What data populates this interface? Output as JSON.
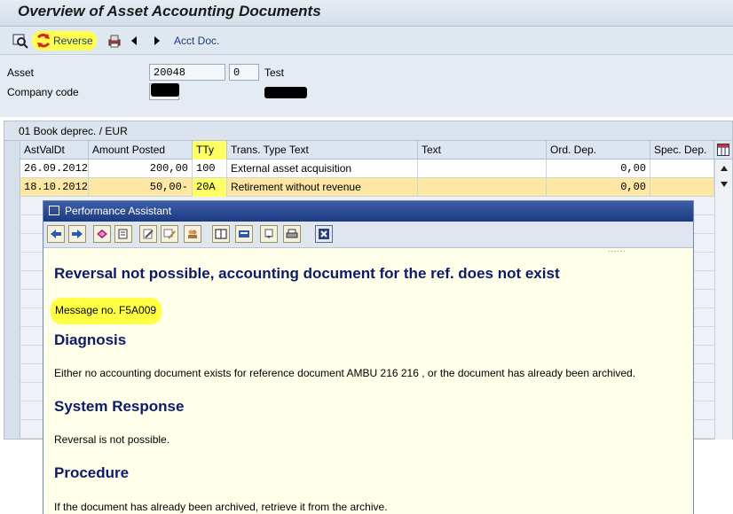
{
  "window": {
    "title": "Overview of Asset Accounting Documents"
  },
  "toolbar": {
    "reverse_label": "Reverse",
    "acct_doc_label": "Acct Doc."
  },
  "header": {
    "asset_label": "Asset",
    "asset_number": "20048",
    "asset_subnumber": "0",
    "asset_description": "Test",
    "company_code_label": "Company code"
  },
  "table": {
    "title": "01 Book deprec. / EUR",
    "columns": [
      "AstValDt",
      "Amount Posted",
      "TTy",
      "Trans. Type Text",
      "Text",
      "Ord. Dep.",
      "Spec. Dep."
    ],
    "rows": [
      {
        "date": "26.09.2012",
        "amount": "200,00",
        "tty": "100",
        "ttext": "External asset acquisition",
        "text": "",
        "ord": "0,00",
        "spec": ""
      },
      {
        "date": "18.10.2012",
        "amount": "50,00-",
        "tty": "20A",
        "ttext": "Retirement without revenue",
        "text": "",
        "ord": "0,00",
        "spec": ""
      }
    ]
  },
  "assistant": {
    "title": "Performance Assistant",
    "message_title": "Reversal not possible, accounting document for the ref. does not exist",
    "message_no": "Message no. F5A009",
    "diagnosis_heading": "Diagnosis",
    "diagnosis_text": "Either no accounting document exists for reference document AMBU  216 216  , or the document has already been archived.",
    "response_heading": "System Response",
    "response_text": "Reversal is not possible.",
    "procedure_heading": "Procedure",
    "procedure_text": "If the document has already been archived, retrieve it from the archive."
  },
  "colors": {
    "highlight": "#ffff44",
    "selected_row": "#fde7a3",
    "heading": "#0c1a6b",
    "titlebar_blue": "#1d3a80"
  }
}
